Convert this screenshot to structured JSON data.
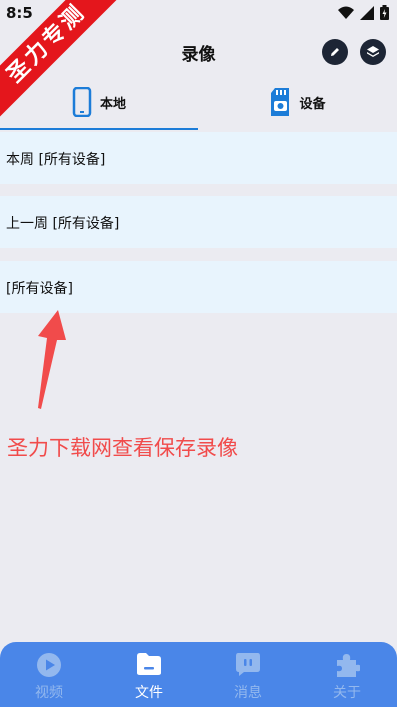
{
  "status_bar": {
    "time": "8:5"
  },
  "watermark": {
    "text": "圣力专测"
  },
  "header": {
    "title": "录像",
    "edit_icon": "pencil-icon",
    "layers_icon": "layers-icon"
  },
  "tabs": [
    {
      "label": "本地",
      "icon": "phone-icon",
      "selected": true
    },
    {
      "label": "设备",
      "icon": "sd-card-camera-icon",
      "selected": false
    }
  ],
  "recordings": [
    {
      "label": "本周 [所有设备]"
    },
    {
      "label": "上一周  [所有设备]"
    },
    {
      "label": "[所有设备]"
    }
  ],
  "annotation": {
    "text": "圣力下载网查看保存录像",
    "color": "#f14b4b"
  },
  "bottom_nav": [
    {
      "label": "视频",
      "icon": "play-icon",
      "active": false
    },
    {
      "label": "文件",
      "icon": "folder-icon",
      "active": true
    },
    {
      "label": "消息",
      "icon": "message-icon",
      "active": false
    },
    {
      "label": "关于",
      "icon": "puzzle-icon",
      "active": false
    }
  ],
  "colors": {
    "accent": "#1c7cd8",
    "nav_bg": "#4a86e8",
    "row_bg": "#e8f4fd",
    "ribbon": "#e4161c"
  }
}
